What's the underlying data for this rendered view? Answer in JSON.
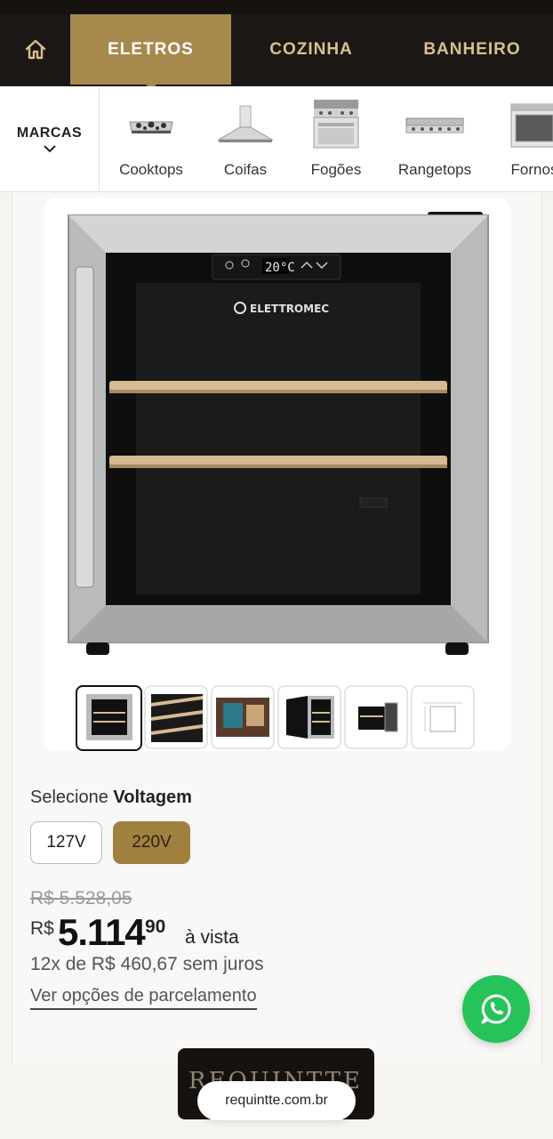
{
  "nav": {
    "home_icon": "home-icon",
    "tabs": [
      {
        "label": "ELETROS",
        "active": true
      },
      {
        "label": "COZINHA",
        "active": false
      },
      {
        "label": "BANHEIRO",
        "active": false
      }
    ]
  },
  "categories": {
    "brands_label": "MARCAS",
    "items": [
      {
        "label": "Cooktops"
      },
      {
        "label": "Coifas"
      },
      {
        "label": "Fogões"
      },
      {
        "label": "Rangetops"
      },
      {
        "label": "Fornos"
      }
    ]
  },
  "product": {
    "brand_on_product": "ELETTROMEC",
    "display_temp": "20°C",
    "thumbnail_count": 6,
    "selected_thumbnail": 1
  },
  "voltage": {
    "prefix": "Selecione",
    "label": "Voltagem",
    "options": [
      {
        "label": "127V",
        "selected": false
      },
      {
        "label": "220V",
        "selected": true
      }
    ]
  },
  "price": {
    "old": "R$ 5.528,05",
    "currency": "R$",
    "integer": "5.114",
    "cents": "90",
    "suffix": "à vista",
    "installments": "12x de R$ 460,67 sem juros",
    "options_link": "Ver opções de parcelamento"
  },
  "footer": {
    "banner_text": "REQUINTTE",
    "url": "requintte.com.br"
  },
  "colors": {
    "gold": "#a8894d",
    "dark": "#1b1714",
    "whatsapp": "#25c35a"
  }
}
